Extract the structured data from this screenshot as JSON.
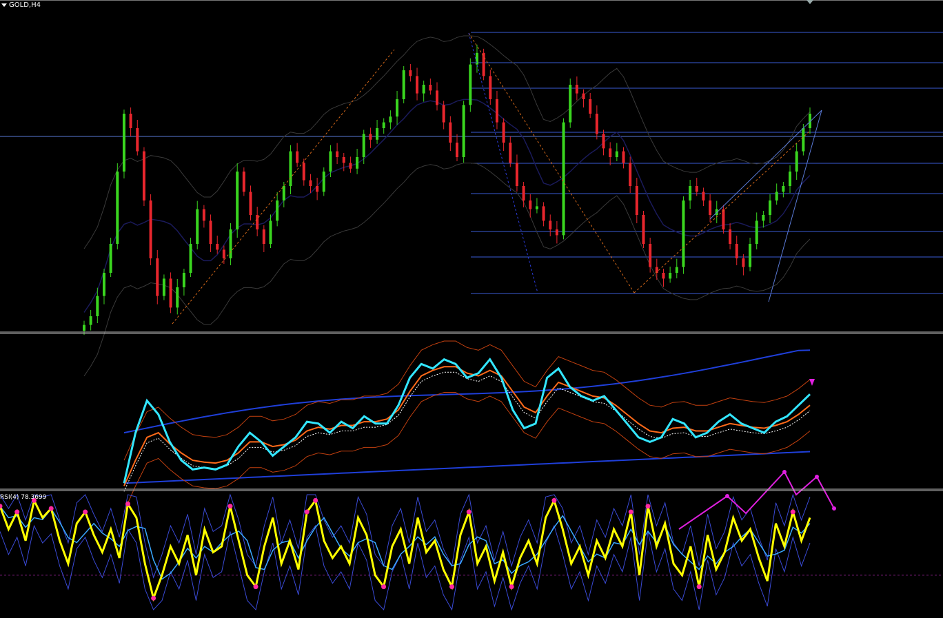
{
  "window": {
    "symbol_title": "GOLD,H4"
  },
  "rsi_panel": {
    "label": "RSI(4) 78.3699"
  },
  "colors": {
    "background": "#000000",
    "bull_candle": "#3ad61f",
    "bear_candle": "#e8262d",
    "fib_lines": "#3a5bd6",
    "bollinger": "#2a2a3f",
    "fast_line": "#33e6ff",
    "signal_line": "#ff6a1a",
    "slow_band": "#1f3fd9",
    "rsi_line": "#ffff00",
    "rsi_markers": "#ff2aa0",
    "annotation": "#e020e0",
    "separator": "#bfbfbf"
  },
  "chart_data": [
    {
      "type": "candlestick",
      "title": "GOLD,H4",
      "series": [
        {
          "name": "price",
          "close": [
            0.02,
            0.05,
            0.12,
            0.2,
            0.3,
            0.55,
            0.75,
            0.7,
            0.62,
            0.45,
            0.25,
            0.12,
            0.18,
            0.08,
            0.15,
            0.2,
            0.3,
            0.42,
            0.38,
            0.3,
            0.28,
            0.25,
            0.35,
            0.55,
            0.48,
            0.4,
            0.35,
            0.3,
            0.38,
            0.45,
            0.5,
            0.62,
            0.58,
            0.52,
            0.5,
            0.48,
            0.55,
            0.62,
            0.6,
            0.58,
            0.56,
            0.6,
            0.68,
            0.66,
            0.7,
            0.72,
            0.74,
            0.8,
            0.9,
            0.88,
            0.82,
            0.85,
            0.83,
            0.78,
            0.72,
            0.65,
            0.6,
            0.78,
            0.92,
            0.96,
            0.88,
            0.8,
            0.72,
            0.65,
            0.58,
            0.5,
            0.45,
            0.42,
            0.43,
            0.38,
            0.35,
            0.33,
            0.72,
            0.85,
            0.82,
            0.8,
            0.75,
            0.68,
            0.63,
            0.6,
            0.62,
            0.58,
            0.5,
            0.4,
            0.3,
            0.22,
            0.2,
            0.18,
            0.2,
            0.22,
            0.45,
            0.5,
            0.48,
            0.45,
            0.4,
            0.42,
            0.35,
            0.3,
            0.25,
            0.22,
            0.3,
            0.38,
            0.4,
            0.45,
            0.48,
            0.5,
            0.55,
            0.62,
            0.7,
            0.75
          ]
        }
      ]
    },
    {
      "type": "line",
      "series": [
        {
          "name": "fast",
          "values": [
            0.05,
            0.6,
            0.95,
            0.8,
            0.5,
            0.3,
            0.2,
            0.22,
            0.2,
            0.25,
            0.45,
            0.6,
            0.5,
            0.35,
            0.45,
            0.55,
            0.72,
            0.7,
            0.6,
            0.72,
            0.65,
            0.78,
            0.7,
            0.7,
            0.9,
            1.2,
            1.35,
            1.3,
            1.4,
            1.35,
            1.2,
            1.25,
            1.4,
            1.2,
            0.85,
            0.65,
            0.7,
            1.2,
            1.3,
            1.1,
            1.0,
            0.95,
            1.0,
            0.85,
            0.7,
            0.55,
            0.5,
            0.55,
            0.75,
            0.7,
            0.55,
            0.6,
            0.72,
            0.8,
            0.7,
            0.65,
            0.6,
            0.72,
            0.78,
            0.9,
            1.02
          ]
        },
        {
          "name": "signal",
          "values": [
            0.02,
            0.3,
            0.55,
            0.6,
            0.48,
            0.38,
            0.3,
            0.28,
            0.27,
            0.3,
            0.38,
            0.5,
            0.5,
            0.45,
            0.47,
            0.52,
            0.62,
            0.66,
            0.64,
            0.68,
            0.68,
            0.72,
            0.72,
            0.75,
            0.85,
            1.05,
            1.22,
            1.28,
            1.32,
            1.32,
            1.25,
            1.22,
            1.28,
            1.22,
            1.05,
            0.88,
            0.82,
            1.0,
            1.15,
            1.1,
            1.05,
            1.0,
            0.98,
            0.9,
            0.8,
            0.7,
            0.62,
            0.6,
            0.65,
            0.66,
            0.62,
            0.62,
            0.66,
            0.7,
            0.68,
            0.66,
            0.65,
            0.68,
            0.72,
            0.8,
            0.9
          ]
        }
      ]
    },
    {
      "type": "line",
      "title": "RSI(4) 78.3699",
      "series": [
        {
          "name": "RSI",
          "values": [
            90,
            70,
            85,
            60,
            95,
            80,
            88,
            60,
            40,
            75,
            85,
            65,
            50,
            70,
            45,
            92,
            80,
            40,
            10,
            30,
            55,
            40,
            65,
            30,
            70,
            50,
            55,
            90,
            60,
            30,
            20,
            55,
            80,
            40,
            60,
            35,
            85,
            95,
            60,
            45,
            55,
            40,
            80,
            65,
            30,
            20,
            55,
            70,
            40,
            80,
            50,
            60,
            35,
            20,
            65,
            85,
            40,
            55,
            25,
            50,
            20,
            45,
            60,
            40,
            80,
            95,
            70,
            40,
            55,
            30,
            60,
            45,
            70,
            55,
            85,
            30,
            90,
            55,
            75,
            40,
            30,
            55,
            20,
            65,
            35,
            50,
            80,
            60,
            70,
            45,
            25,
            75,
            55,
            85,
            60,
            80
          ]
        }
      ]
    }
  ]
}
